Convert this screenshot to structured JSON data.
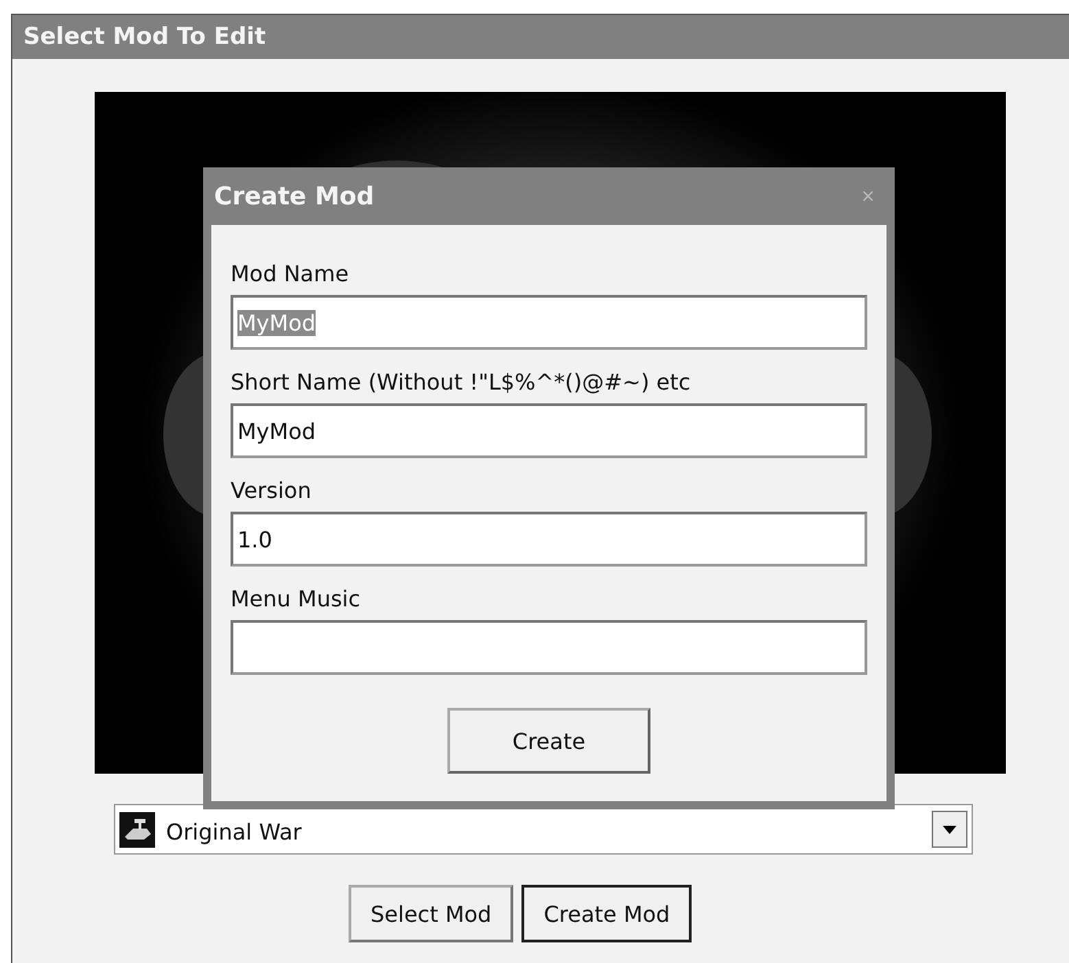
{
  "window": {
    "title": "Select Mod To Edit"
  },
  "mod_dropdown": {
    "value": "Original War"
  },
  "buttons": [
    {
      "label": "Select Mod",
      "default": false
    },
    {
      "label": "Create Mod",
      "default": true
    }
  ],
  "dialog": {
    "title": "Create Mod",
    "close": "×",
    "fields": [
      {
        "label": "Mod Name",
        "value": "MyMod",
        "text_selected": true
      },
      {
        "label": "Short Name (Without !\"L$%^*()@#~) etc",
        "value": "MyMod",
        "text_selected": false
      },
      {
        "label": "Version",
        "value": "1.0",
        "text_selected": false
      },
      {
        "label": "Menu Music"
      }
    ],
    "button": "Create"
  }
}
